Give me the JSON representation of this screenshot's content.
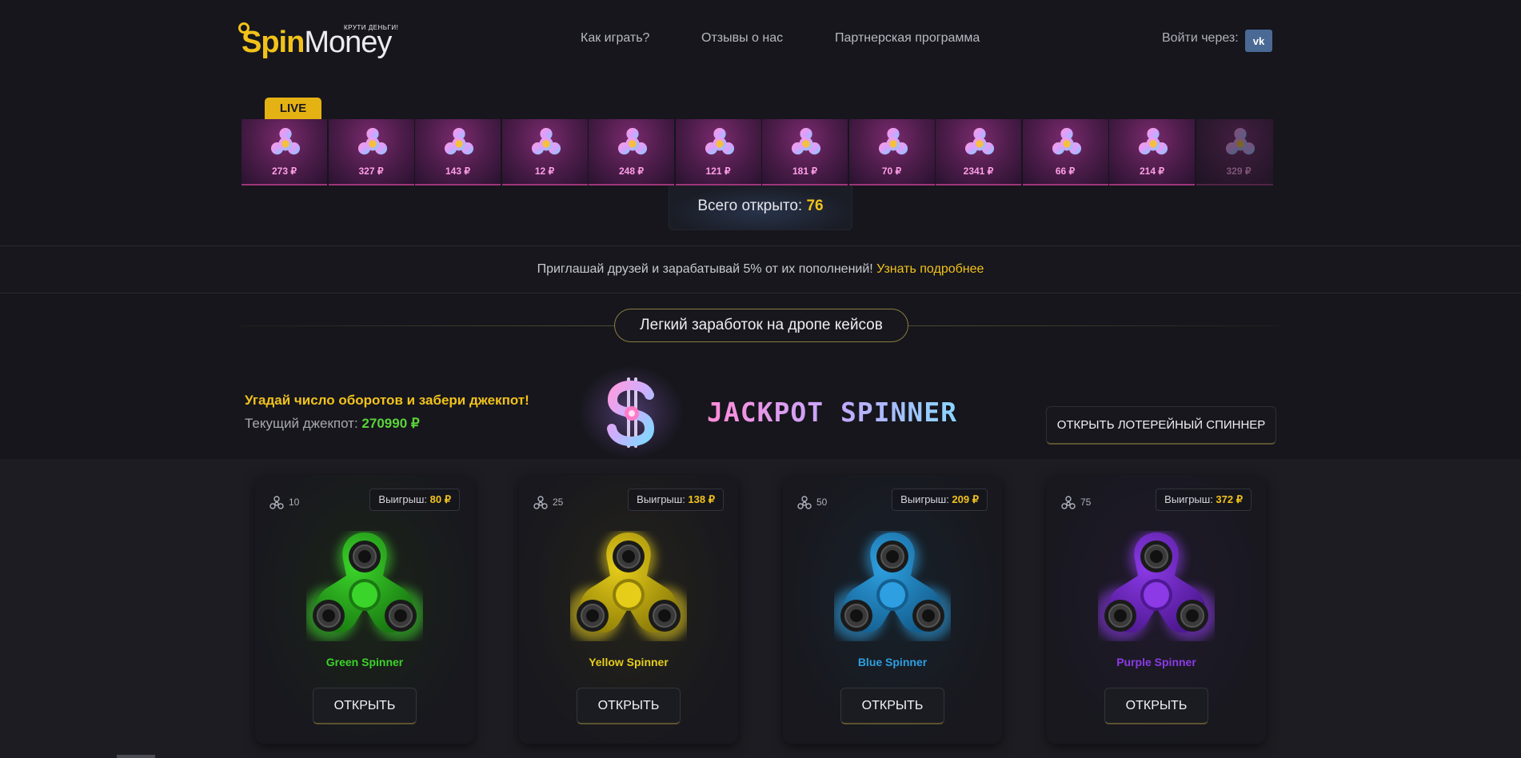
{
  "header": {
    "logo": {
      "spin": "Spin",
      "money": "Money",
      "tagline": "КРУТИ ДЕНЬГИ!"
    },
    "nav": [
      "Как играть?",
      "Отзывы о нас",
      "Партнерская программа"
    ],
    "login_label": "Войти через:",
    "vk_label": "vk"
  },
  "live": {
    "badge": "LIVE",
    "drops": [
      "273 ₽",
      "327 ₽",
      "143 ₽",
      "12 ₽",
      "248 ₽",
      "121 ₽",
      "181 ₽",
      "70 ₽",
      "2341 ₽",
      "66 ₽",
      "214 ₽",
      "329 ₽"
    ],
    "total_label": "Всего открыто: ",
    "total_value": "76"
  },
  "promo": {
    "text": "Приглашай друзей и зарабатывай 5% от их пополнений! ",
    "link": "Узнать подробнее"
  },
  "section_title": "Легкий заработок на дропе кейсов",
  "jackpot": {
    "headline": "Угадай число оборотов и забери джекпот!",
    "current_label": "Текущий джекпот: ",
    "current_value": "270990 ₽",
    "logo_text": "JACKPOT SPINNER",
    "button": "ОТКРЫТЬ ЛОТЕРЕЙНЫЙ СПИННЕР"
  },
  "cards": [
    {
      "count": "10",
      "win_label": "Выигрыш: ",
      "win_value": "80 ₽",
      "name": "Green Spinner",
      "button": "ОТКРЫТЬ",
      "color": "#3bd42a",
      "dark": "#1a7a12",
      "bg": "#1b2418"
    },
    {
      "count": "25",
      "win_label": "Выигрыш: ",
      "win_value": "138 ₽",
      "name": "Yellow Spinner",
      "button": "ОТКРЫТЬ",
      "color": "#e6cd1a",
      "dark": "#8f7e08",
      "bg": "#24231a"
    },
    {
      "count": "50",
      "win_label": "Выигрыш: ",
      "win_value": "209 ₽",
      "name": "Blue Spinner",
      "button": "ОТКРЫТЬ",
      "color": "#2e9fe0",
      "dark": "#145f8f",
      "bg": "#17212a"
    },
    {
      "count": "75",
      "win_label": "Выигрыш: ",
      "win_value": "372 ₽",
      "name": "Purple Spinner",
      "button": "ОТКРЫТЬ",
      "color": "#8b3ae6",
      "dark": "#4e1891",
      "bg": "#201a2c"
    }
  ],
  "colors": {
    "accent": "#f2c21b",
    "jackpot_value": "#5bd33a",
    "drop_amount": "#ff9fe8"
  }
}
